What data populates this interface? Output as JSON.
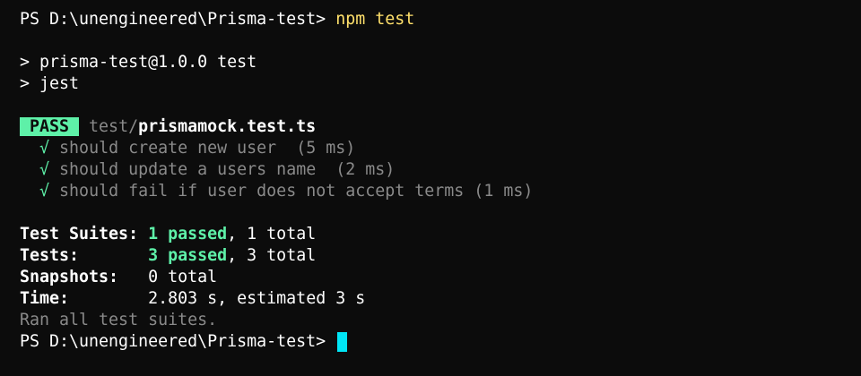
{
  "prompt1": {
    "path": "PS D:\\unengineered\\Prisma-test> ",
    "command": "npm test"
  },
  "script": {
    "line1": "> prisma-test@1.0.0 test",
    "line2": "> jest"
  },
  "result": {
    "badge": "PASS",
    "dir": "test/",
    "file": "prismamock.test.ts",
    "tests": [
      {
        "mark": "√",
        "text": "should create new user  (5 ms)"
      },
      {
        "mark": "√",
        "text": "should update a users name  (2 ms)"
      },
      {
        "mark": "√",
        "text": "should fail if user does not accept terms (1 ms)"
      }
    ]
  },
  "summary": {
    "suites_label": "Test Suites: ",
    "suites_passed": "1 passed",
    "suites_total": ", 1 total",
    "tests_label": "Tests:       ",
    "tests_passed": "3 passed",
    "tests_total": ", 3 total",
    "snapshots_label": "Snapshots:   ",
    "snapshots_value": "0 total",
    "time_label": "Time:        ",
    "time_value": "2.803 s, estimated 3 s",
    "ran": "Ran all test suites."
  },
  "prompt2": {
    "path": "PS D:\\unengineered\\Prisma-test> "
  },
  "colors": {
    "background": "#0c0c0c",
    "pass_badge": "#5ef0a8",
    "command": "#ffe06b",
    "cursor": "#00e5f5"
  }
}
